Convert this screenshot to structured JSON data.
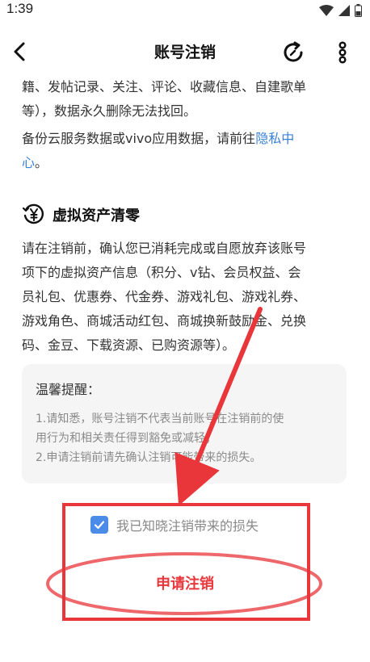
{
  "status_bar": {
    "time": "1:39",
    "icons": [
      "wifi-icon",
      "signal-icon",
      "battery-icon"
    ]
  },
  "header": {
    "title": "账号注销",
    "icons": [
      "back-icon",
      "refresh-icon",
      "more-icon"
    ]
  },
  "content": {
    "data_para": [
      "籍、发帖记录、关注、评论、收藏信息、自建歌单",
      "等），数据永久删除无法找回。"
    ],
    "cloud_para_prefix": "备份云服务数据或vivo应用数据，请前往",
    "cloud_link_1": "隐私中",
    "cloud_link_2": "心",
    "cloud_para_suffix": "。",
    "section_title": "虚拟资产清零",
    "section_icon": "yen-clock-icon",
    "asset_para": [
      "请在注销前，确认您已消耗完成或自愿放弃该账号",
      "项下的虚拟资产信息（积分、v钻、会员权益、会",
      "员礼包、优惠券、代金券、游戏礼包、游戏礼券、",
      "游戏角色、商城活动红包、商城换新鼓励金、兑换",
      "码、金豆、下载资源、已购资源等）。"
    ]
  },
  "tips": {
    "title": "温馨提醒：",
    "lines": [
      "1.请知悉，账号注销不代表当前账号在注销前的使",
      "用行为和相关责任得到豁免或减轻；",
      "2.申请注销前请先确认注销可能带来的损失。"
    ]
  },
  "agree": {
    "label": "我已知晓注销带来的损失",
    "checked": true
  },
  "apply_button": {
    "label": "申请注销"
  },
  "colors": {
    "accent": "#4a8ce8",
    "link": "#3b82d9",
    "danger": "#e8363a",
    "annotation": "#e8363a"
  }
}
